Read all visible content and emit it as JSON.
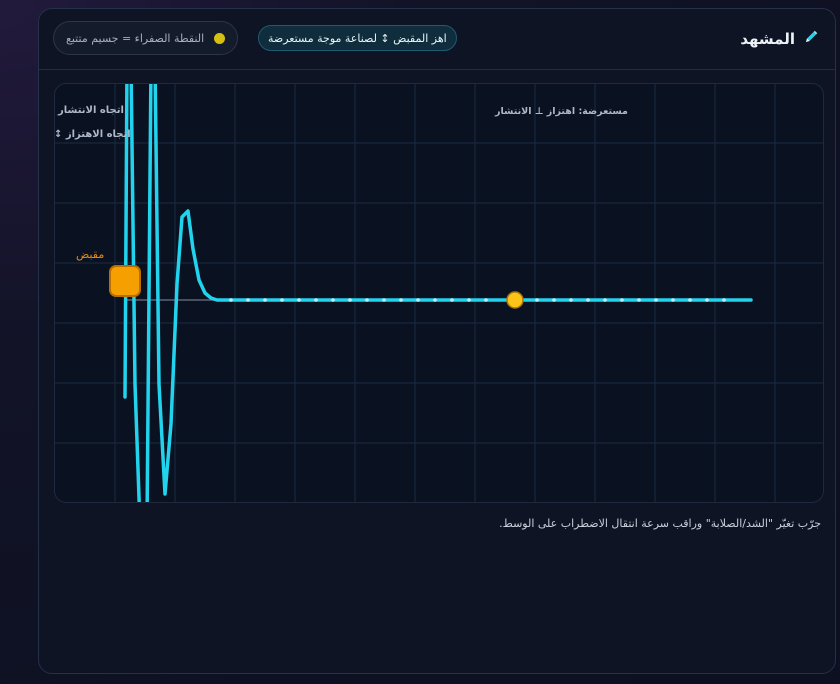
{
  "header": {
    "title": "المشهد",
    "title_icon": "pencil-icon",
    "hint_label": "اهز المقبض ↕ لصناعة موجة مستعرضة",
    "legend_label": "النقطة الصفراء = جسيم متتبع"
  },
  "scene": {
    "propagation_label": "اتجاه الانتشار",
    "oscillation_label": "اتجاه الاهتزاز ↕",
    "mode_label": "مستعرضة: اهتزاز ⊥ الانتشار",
    "handle_label": "مقبض"
  },
  "footer": {
    "tip": "جرّب تغيّر \"الشد/الصلابة\" وراقب سرعة انتقال الاضطراب على الوسط."
  },
  "colors": {
    "wave": "#22d3ee",
    "tracer": "#fcc419",
    "handle": "#f59f00",
    "handle_label": "#e8890c",
    "grid": "#1b2942"
  }
}
